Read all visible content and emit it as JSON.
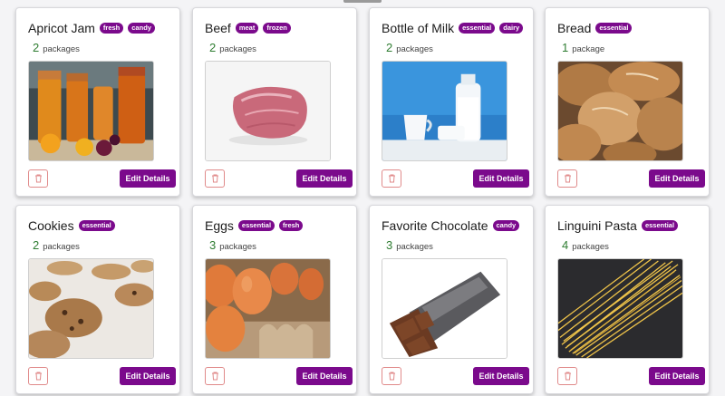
{
  "products": [
    {
      "name": "Apricot Jam",
      "tags": [
        "fresh",
        "candy"
      ],
      "quantity": "2",
      "unit": "packages",
      "image": "apricot-jam-jars",
      "action": "Edit Details"
    },
    {
      "name": "Beef",
      "tags": [
        "meat",
        "frozen"
      ],
      "quantity": "2",
      "unit": "packages",
      "image": "raw-beef",
      "action": "Edit Details"
    },
    {
      "name": "Bottle of Milk",
      "tags": [
        "essential",
        "dairy"
      ],
      "quantity": "2",
      "unit": "packages",
      "image": "milk-bottle",
      "action": "Edit Details"
    },
    {
      "name": "Bread",
      "tags": [
        "essential"
      ],
      "quantity": "1",
      "unit": "package",
      "image": "bread-loaves",
      "action": "Edit Details"
    },
    {
      "name": "Cookies",
      "tags": [
        "essential"
      ],
      "quantity": "2",
      "unit": "packages",
      "image": "cookies",
      "action": "Edit Details"
    },
    {
      "name": "Eggs",
      "tags": [
        "essential",
        "fresh"
      ],
      "quantity": "3",
      "unit": "packages",
      "image": "eggs-in-carton",
      "action": "Edit Details"
    },
    {
      "name": "Favorite Chocolate",
      "tags": [
        "candy"
      ],
      "quantity": "3",
      "unit": "packages",
      "image": "chocolate-bar",
      "action": "Edit Details"
    },
    {
      "name": "Linguini Pasta",
      "tags": [
        "essential"
      ],
      "quantity": "4",
      "unit": "packages",
      "image": "linguini-pasta",
      "action": "Edit Details"
    }
  ],
  "colors": {
    "accent": "#7b0a8c",
    "quantity": "#2f7d32",
    "delete_border": "#e08a8a"
  },
  "icons": {
    "delete": "trash-icon"
  }
}
